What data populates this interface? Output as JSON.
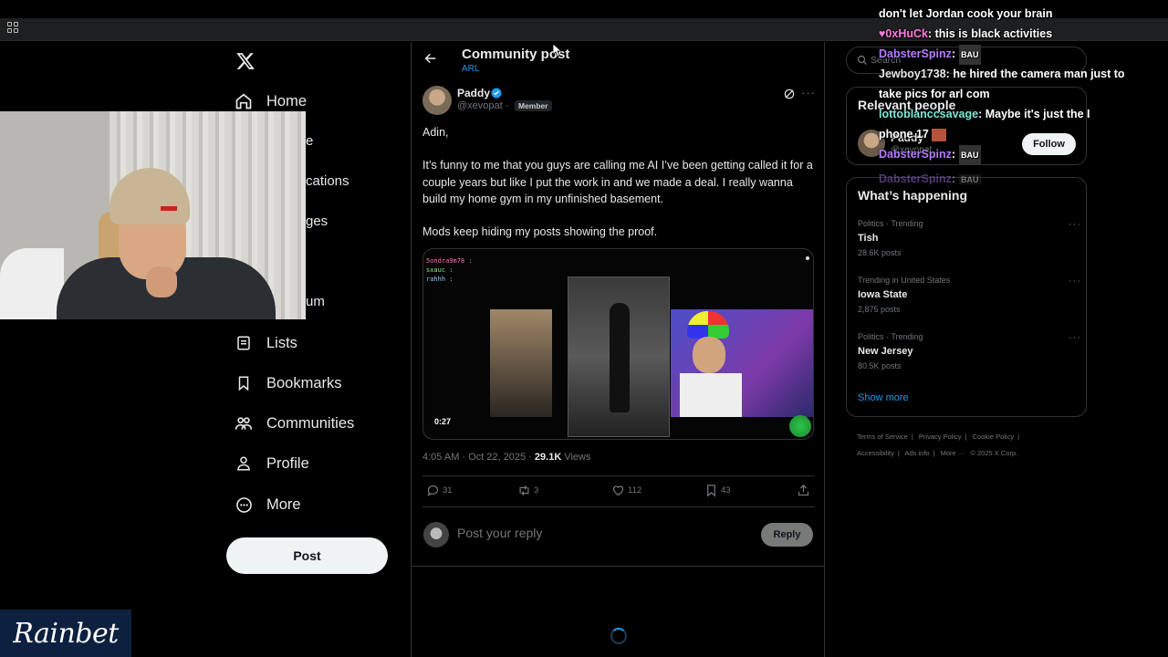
{
  "nav": {
    "items": [
      {
        "label": "Home",
        "icon": "home-icon"
      },
      {
        "label": "Lists",
        "icon": "list-icon"
      },
      {
        "label": "Bookmarks",
        "icon": "bookmark-icon"
      },
      {
        "label": "Communities",
        "icon": "communities-icon"
      },
      {
        "label": "Profile",
        "icon": "profile-icon"
      },
      {
        "label": "More",
        "icon": "more-circle-icon"
      }
    ],
    "partial_labels": [
      "e",
      "cations",
      "ges",
      "um"
    ],
    "post_label": "Post"
  },
  "header": {
    "title": "Community post",
    "community": "ARL"
  },
  "post": {
    "author": "Paddy",
    "handle": "@xevopat",
    "badge": "Member",
    "paragraphs": [
      "Adin,",
      "It’s funny to me that you guys are calling me AI I’ve been getting called it for a couple years but like I put the work in and we made a deal. I really wanna build my home gym in my unfinished basement.",
      "Mods keep hiding my posts showing the proof."
    ],
    "video_duration": "0:27",
    "media_chat": [
      "5ondra9m78 : ",
      "sxauc : ",
      "rahhh : "
    ],
    "timestamp": "4:05 AM · Oct 22, 2025 · ",
    "views_count": "29.1K",
    "views_label": " Views",
    "stats": {
      "replies": "31",
      "reposts": "3",
      "likes": "112",
      "bookmarks": "43"
    }
  },
  "reply": {
    "placeholder": "Post your reply",
    "button": "Reply"
  },
  "sidebar": {
    "search_placeholder": "Search",
    "relevant_title": "Relevant people",
    "relevant_person": {
      "name": "Paddy",
      "handle": "@xevopat"
    },
    "follow_label": "Follow",
    "whats_happening_title": "What’s happening",
    "trends": [
      {
        "meta": "Politics · Trending",
        "topic": "Tish",
        "count": "28.6K posts"
      },
      {
        "meta": "Trending in United States",
        "topic": "Iowa State",
        "count": "2,875 posts"
      },
      {
        "meta": "Politics · Trending",
        "topic": "New Jersey",
        "count": "80.5K posts"
      }
    ],
    "show_more": "Show more",
    "footer": [
      "Terms of Service",
      "|",
      "Privacy Policy",
      "|",
      "Cookie Policy",
      "|",
      "Accessibility",
      "|",
      "Ads info",
      "|",
      "More ···",
      "© 2025 X Corp."
    ]
  },
  "chat": [
    {
      "user": "",
      "msg": "don't let Jordan cook your brain"
    },
    {
      "user": "0xHuCk",
      "msg": " this is black activities"
    },
    {
      "user": "DabsterSpinz",
      "msg": ""
    },
    {
      "user": "Jewboy1738",
      "msg": " he hired the camera man just to"
    },
    {
      "user": "",
      "msg": "take pics for arl com"
    },
    {
      "user": "lottoblanccsavage",
      "msg": " Maybe it's just the I"
    },
    {
      "user": "",
      "msg": "phone 17"
    },
    {
      "user": "DabsterSpinz",
      "msg": ""
    },
    {
      "user": "DabsterSpinz",
      "msg": ""
    }
  ],
  "chat_badge": "BAU",
  "sponsor": "Rainbet",
  "colors": {
    "accent": "#1d9bf0",
    "background": "#000000",
    "border": "#2f3336"
  }
}
